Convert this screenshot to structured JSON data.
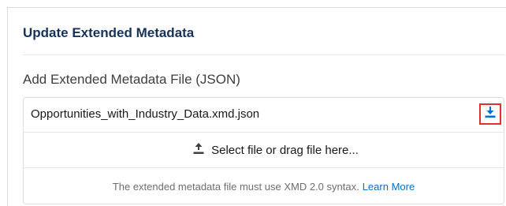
{
  "panel": {
    "title": "Update Extended Metadata",
    "section_label": "Add Extended Metadata File (JSON)"
  },
  "file": {
    "name": "Opportunities_with_Industry_Data.xmd.json",
    "download_icon": "download-icon"
  },
  "dropzone": {
    "label": "Select file or drag file here...",
    "icon": "upload-icon"
  },
  "help": {
    "text": "The extended metadata file must use XMD 2.0 syntax.",
    "link_label": "Learn More"
  },
  "colors": {
    "accent": "#0070d2",
    "highlight_border": "#e03030",
    "title": "#16325c"
  }
}
